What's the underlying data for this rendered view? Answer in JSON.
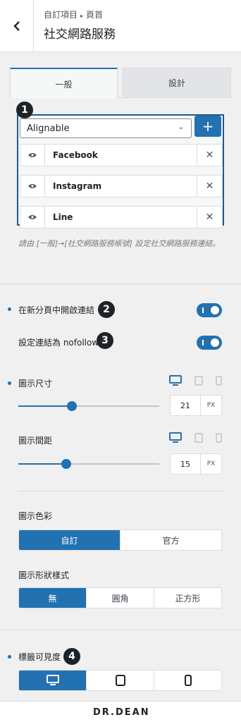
{
  "header": {
    "back_icon": "chevron-left-icon",
    "breadcrumb_parent": "自訂項目",
    "breadcrumb_sep": "▸",
    "breadcrumb_current": "頁首",
    "title": "社交網路服務"
  },
  "tabs": [
    {
      "label": "一般",
      "active": true
    },
    {
      "label": "設計",
      "active": false
    }
  ],
  "badges": [
    "1",
    "2",
    "3",
    "4"
  ],
  "social": {
    "select_value": "Alignable",
    "add_label": "+",
    "items": [
      {
        "name": "Facebook",
        "visible": true
      },
      {
        "name": "Instagram",
        "visible": true
      },
      {
        "name": "Line",
        "visible": true
      }
    ],
    "remove_label": "✕",
    "hint": "請由 [一般]→[社交網路服務帳號] 設定社交網路服務連結。"
  },
  "open_new_tab": {
    "label": "在新分頁中開啟連結",
    "on": true
  },
  "nofollow": {
    "label": "設定連結為 nofollow",
    "on": true
  },
  "icon_size": {
    "label": "圖示尺寸",
    "value": "21",
    "unit": "PX",
    "level": 0.38,
    "device": "desktop"
  },
  "icon_spacing": {
    "label": "圖示間距",
    "value": "15",
    "unit": "PX",
    "level": 0.34,
    "device": "desktop"
  },
  "icon_color": {
    "label": "圖示色彩",
    "options": [
      "自訂",
      "官方"
    ],
    "selected": 0
  },
  "icon_shape": {
    "label": "圖示形狀樣式",
    "options": [
      "無",
      "圓角",
      "正方形"
    ],
    "selected": 0
  },
  "label_visibility": {
    "label": "標籤可見度",
    "options": [
      "desktop-icon",
      "tablet-icon",
      "mobile-icon"
    ],
    "selected": 0
  },
  "footer": {
    "logo": "DR.DEAN"
  },
  "colors": {
    "accent": "#2271b1",
    "badge": "#1d2327",
    "panel_bg": "#f0f0f1"
  }
}
